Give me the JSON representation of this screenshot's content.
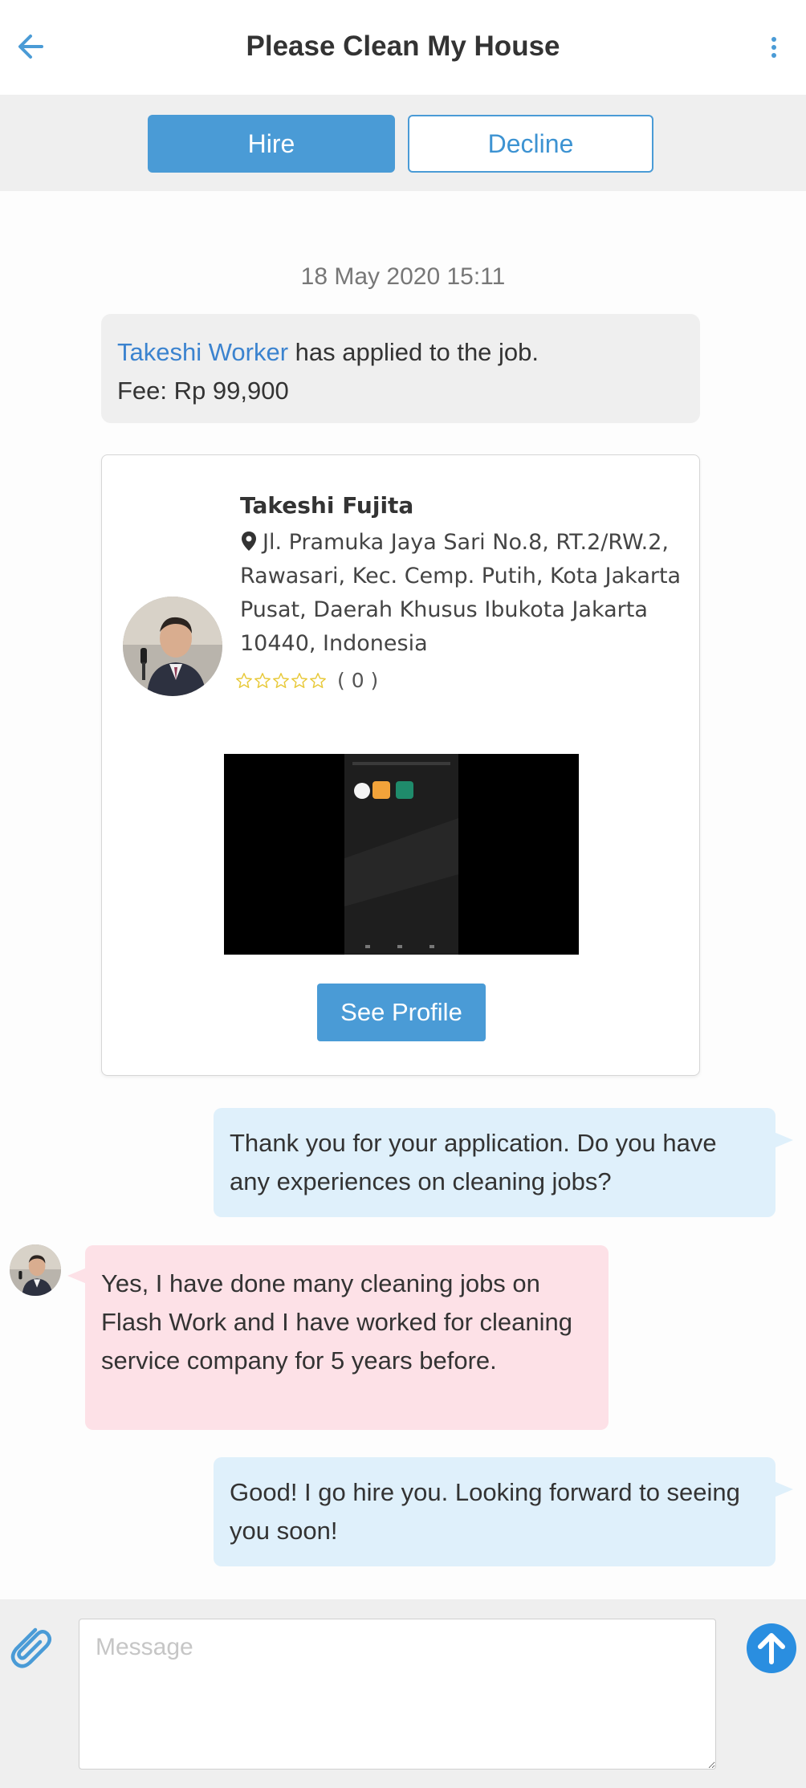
{
  "header": {
    "title": "Please Clean My House",
    "back_icon": "arrow-left-icon",
    "more_icon": "vertical-dots-icon"
  },
  "actions": {
    "hire_label": "Hire",
    "decline_label": "Decline"
  },
  "chat": {
    "timestamp": "18 May 2020 15:11",
    "system_message": {
      "worker_name": "Takeshi Worker",
      "text": " has applied to the job.",
      "fee": "Fee: Rp 99,900"
    },
    "profile_card": {
      "name": "Takeshi Fujita",
      "address": "Jl. Pramuka Jaya Sari No.8, RT.2/RW.2, Rawasari, Kec. Cemp. Putih, Kota Jakarta Pusat, Daerah Khusus Ibukota Jakarta 10440, Indonesia",
      "rating_stars": 0,
      "rating_max": 5,
      "rating_count": "( 0 )",
      "see_profile_label": "See Profile"
    },
    "messages": [
      {
        "direction": "outgoing",
        "text": "Thank you for your application. Do you have any experiences on cleaning jobs?"
      },
      {
        "direction": "incoming",
        "text": "Yes, I have done many cleaning jobs on Flash Work and I have worked for cleaning service company for 5 years before."
      },
      {
        "direction": "outgoing",
        "text": "Good! I go hire you. Looking forward to seeing you soon!"
      }
    ]
  },
  "composer": {
    "placeholder": "Message",
    "value": "",
    "attach_icon": "paperclip-icon",
    "send_icon": "arrow-up-circle-icon"
  },
  "colors": {
    "accent": "#4a9bd6",
    "link": "#3b83cf",
    "outgoing_bubble": "#dff0fb",
    "incoming_bubble": "#fde1e7",
    "system_bubble": "#efefef",
    "star": "#e8c93a"
  }
}
